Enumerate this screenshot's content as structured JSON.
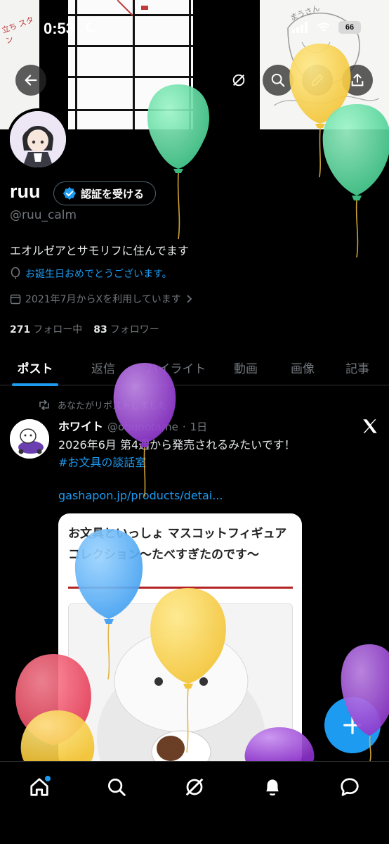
{
  "status_bar": {
    "time": "0:53",
    "battery": "66"
  },
  "profile": {
    "display_name": "ruu",
    "verify_label": "認証を受ける",
    "handle": "@ruu_calm",
    "bio": "エオルゼアとサモリフに住んでます",
    "birthday_text": "お誕生日おめでとうございます。",
    "joined_text": "2021年7月からXを利用しています",
    "following_count": "271",
    "following_label": "フォロー中",
    "followers_count": "83",
    "followers_label": "フォロワー"
  },
  "tabs": [
    {
      "label": "ポスト",
      "active": true
    },
    {
      "label": "返信"
    },
    {
      "label": "ハイライト"
    },
    {
      "label": "動画"
    },
    {
      "label": "画像"
    },
    {
      "label": "記事"
    }
  ],
  "post": {
    "repost_label": "あなたがリポストしました",
    "author_name": "ホワイト",
    "author_handle": "@obunotame",
    "time": "1日",
    "text_line1": "2026年6月 第4週から発売されるみたいです！",
    "hashtag": "#お文具の談話室",
    "link": "gashapon.jp/products/detai...",
    "card_title": "お文具といっしょ マスコットフィギュアコレクション〜たべすぎたのです〜"
  },
  "banner": {
    "scribble_1": "立ち スタン",
    "scribble_2": "まうさん"
  },
  "colors": {
    "accent": "#1d9bf0",
    "background": "#000000",
    "muted": "#71767b"
  },
  "icons": {
    "back": "arrow-left-icon",
    "grok": "grok-icon",
    "search": "search-icon",
    "edit": "pencil-icon",
    "share": "share-icon",
    "verified": "verified-badge-icon",
    "location": "balloon-pin-icon",
    "calendar": "calendar-icon",
    "repost": "repost-icon",
    "x": "x-logo-icon",
    "compose": "plus-icon",
    "nav": [
      "home-icon",
      "search-icon",
      "grok-icon",
      "bell-icon",
      "chat-icon"
    ]
  }
}
